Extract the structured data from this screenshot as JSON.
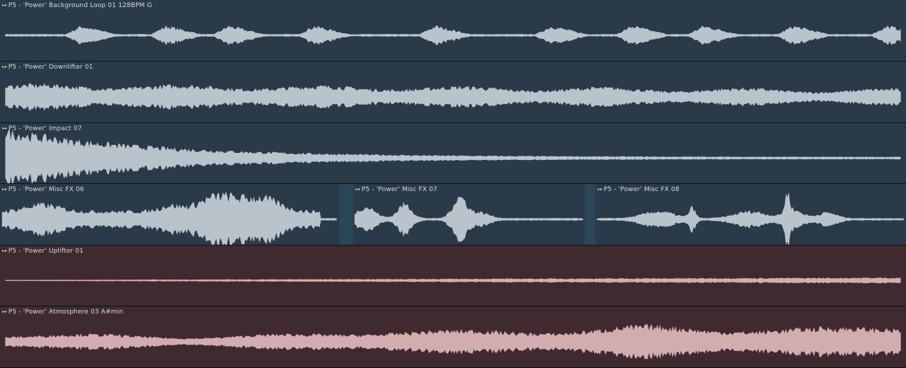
{
  "colors": {
    "blue_clip": "#2a3a48",
    "blue_wave": "#b8c3cc",
    "red_clip": "#3f2b2f",
    "red_wave": "#d2adaf",
    "gap": "#2b4656"
  },
  "tracks": [
    {
      "clips": [
        {
          "title": "P5 - 'Power' Background Loop 01 128BPM G",
          "color": "blue",
          "wave": "pulses"
        }
      ]
    },
    {
      "clips": [
        {
          "title": "P5 - 'Power' Downlifter 01",
          "color": "blue",
          "wave": "downlifter"
        }
      ]
    },
    {
      "clips": [
        {
          "title": "P5 - 'Power' Impact 07",
          "color": "blue",
          "wave": "impact"
        }
      ]
    },
    {
      "clips": [
        {
          "title": "P5 - 'Power' Misc FX 06",
          "color": "blue",
          "wave": "fx06"
        },
        {
          "title": "P5 - 'Power' Misc FX 07",
          "color": "blue",
          "wave": "fx07"
        },
        {
          "title": "P5 - 'Power' Misc FX 08",
          "color": "blue",
          "wave": "fx08"
        }
      ]
    },
    {
      "clips": [
        {
          "title": "P5 - 'Power' Uplifter 01",
          "color": "red",
          "wave": "uplifter"
        }
      ]
    },
    {
      "clips": [
        {
          "title": "P5 - 'Power' Atmosphere 03 A#min",
          "color": "red",
          "wave": "atmos"
        }
      ]
    }
  ]
}
